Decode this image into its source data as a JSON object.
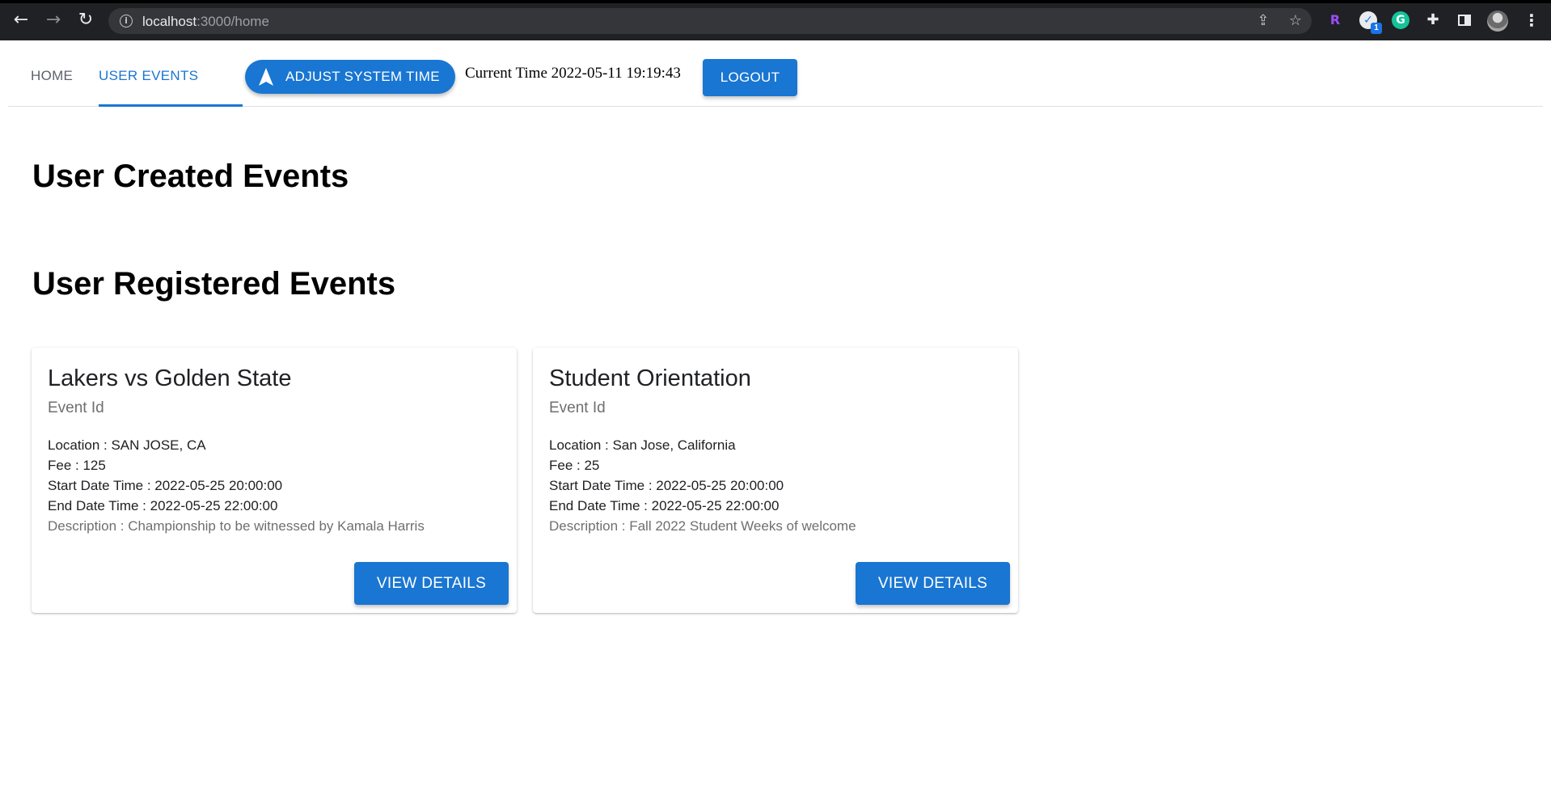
{
  "browser": {
    "url_host": "localhost",
    "url_path": ":3000/home",
    "icons": [
      "back-arrow-icon",
      "forward-arrow-icon",
      "reload-icon",
      "info-icon",
      "share-icon",
      "bookmark-star-icon",
      "extension-r-icon",
      "extension-check-icon",
      "extension-grammarly-icon",
      "extensions-puzzle-icon",
      "side-panel-icon",
      "profile-avatar",
      "more-menu-icon"
    ],
    "ext_r": "R",
    "ext_check_badge": "1",
    "ext_g": "G"
  },
  "header": {
    "tabs": [
      {
        "label": "HOME"
      },
      {
        "label": "USER EVENTS"
      }
    ],
    "adjust_time_label": "ADJUST SYSTEM TIME",
    "current_time": "Current Time 2022-05-11 19:19:43",
    "logout_label": "LOGOUT"
  },
  "main": {
    "created_heading": "User Created Events",
    "registered_heading": "User Registered Events",
    "events": [
      {
        "title": "Lakers vs Golden State",
        "subtitle": "Event Id",
        "location": "Location : SAN JOSE, CA",
        "fee": "Fee : 125",
        "start": "Start Date Time : 2022-05-25 20:00:00",
        "end": "End Date Time : 2022-05-25 22:00:00",
        "description": "Description : Championship to be witnessed by Kamala Harris",
        "button_label": "VIEW DETAILS"
      },
      {
        "title": "Student Orientation",
        "subtitle": "Event Id",
        "location": "Location : San Jose, California",
        "fee": "Fee : 25",
        "start": "Start Date Time : 2022-05-25 20:00:00",
        "end": "End Date Time : 2022-05-25 22:00:00",
        "description": "Description : Fall 2022 Student Weeks of welcome",
        "button_label": "VIEW DETAILS"
      }
    ]
  },
  "colors": {
    "primary": "#1976d2",
    "chrome_bg": "#202124",
    "omnibox_bg": "#35363a"
  }
}
